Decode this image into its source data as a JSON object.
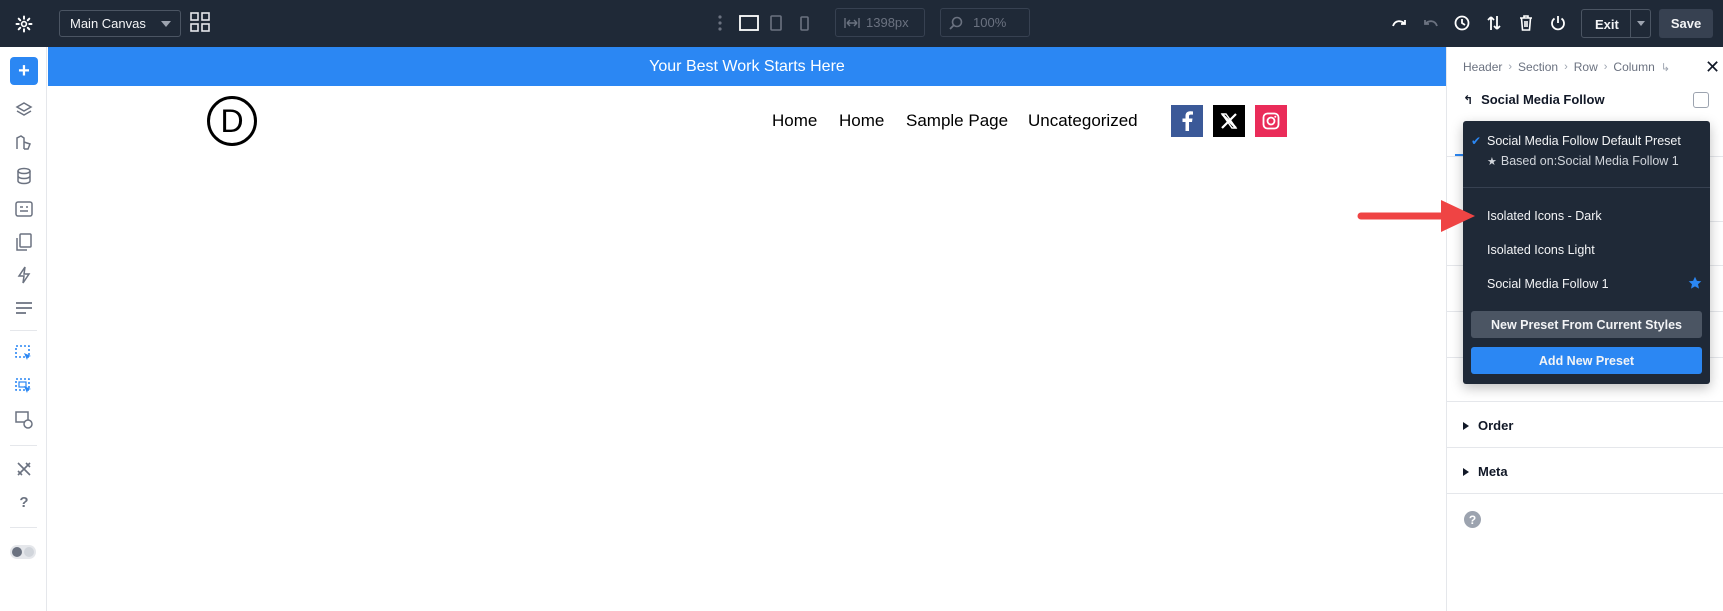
{
  "toolbar": {
    "canvas_select": "Main Canvas",
    "width_value": "1398px",
    "zoom_value": "100%",
    "exit_label": "Exit",
    "save_label": "Save"
  },
  "page": {
    "banner_text": "Your Best Work Starts Here",
    "logo_letter": "D",
    "nav": [
      "Home",
      "Home",
      "Sample Page",
      "Uncategorized"
    ],
    "social": [
      {
        "name": "facebook",
        "color": "#3b5998",
        "glyph": "f"
      },
      {
        "name": "x-twitter",
        "color": "#000000",
        "glyph": "X"
      },
      {
        "name": "instagram",
        "color": "#ea2c59",
        "glyph": "ig"
      }
    ]
  },
  "panel": {
    "breadcrumbs": [
      "Header",
      "Section",
      "Row",
      "Column"
    ],
    "module_title": "Social Media Follow",
    "sections": [
      "Order",
      "Meta"
    ]
  },
  "presets": {
    "default_name": "Social Media Follow Default Preset",
    "based_on": "Based on:Social Media Follow 1",
    "items": [
      "Isolated Icons - Dark",
      "Isolated Icons Light",
      "Social Media Follow 1"
    ],
    "new_from_current": "New Preset From Current Styles",
    "add_new": "Add New Preset"
  },
  "colors": {
    "accent": "#2b87f3",
    "toolbar_bg": "#1f2937",
    "dropdown_bg": "#1f2937",
    "arrow": "#ef4444"
  }
}
